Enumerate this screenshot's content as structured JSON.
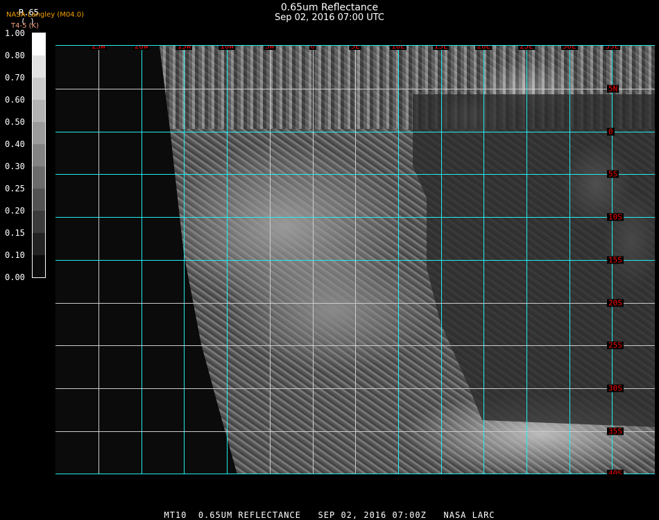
{
  "header": {
    "title": "0.65um Reflectance",
    "datetime": "Sep 02, 2016 07:00 UTC"
  },
  "colorbar": {
    "variable": "R.65",
    "paren": "( )",
    "source": "NASA Langley (M04.0)",
    "subtitle": "T4-5 (K)",
    "labels": [
      "1.00",
      "0.80",
      "0.70",
      "0.60",
      "0.50",
      "0.40",
      "0.30",
      "0.25",
      "0.20",
      "0.15",
      "0.10",
      "0.00"
    ],
    "colors": [
      "#ffffff",
      "#e3e3e3",
      "#cbcbcb",
      "#b3b3b3",
      "#9b9b9b",
      "#838383",
      "#6b6b6b",
      "#535353",
      "#3b3b3b",
      "#232323",
      "#0b0b0b"
    ]
  },
  "map": {
    "longitudes": [
      "25W",
      "20W",
      "15W",
      "10W",
      "5W",
      "0",
      "5E",
      "10E",
      "15E",
      "20E",
      "25E",
      "30E",
      "35E"
    ],
    "latitudes": [
      "5N",
      "0",
      "5S",
      "10S",
      "15S",
      "20S",
      "25S",
      "30S",
      "35S",
      "40S"
    ],
    "grid_color": "#22eeee"
  },
  "footer": {
    "text": "MT10  0.65UM REFLECTANCE   SEP 02, 2016 07:00Z   NASA LARC"
  }
}
